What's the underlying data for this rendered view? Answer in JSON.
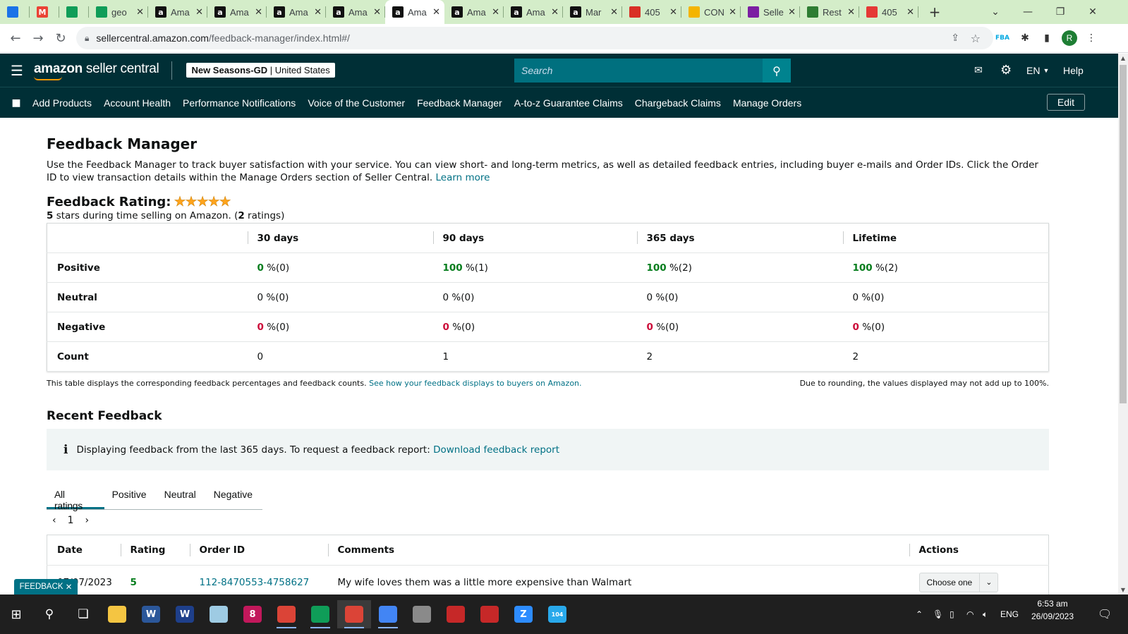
{
  "browser": {
    "tabs": [
      {
        "label": "",
        "icon": "chrome-app-icon",
        "color": "#1a73e8",
        "narrow": true
      },
      {
        "label": "",
        "icon": "gmail-icon",
        "color": "#ea4335",
        "narrow": true
      },
      {
        "label": "",
        "icon": "google-sheets-plus-icon",
        "color": "#0f9d58",
        "narrow": true
      },
      {
        "label": "geo",
        "icon": "google-sheets-icon",
        "color": "#0f9d58"
      },
      {
        "label": "Ama",
        "icon": "amazon-icon",
        "color": "#111111"
      },
      {
        "label": "Ama",
        "icon": "amazon-icon",
        "color": "#111111"
      },
      {
        "label": "Ama",
        "icon": "amazon-icon",
        "color": "#111111"
      },
      {
        "label": "Ama",
        "icon": "amazon-icon",
        "color": "#111111"
      },
      {
        "label": "Ama",
        "icon": "amazon-icon",
        "color": "#111111",
        "active": true
      },
      {
        "label": "Ama",
        "icon": "amazon-icon",
        "color": "#111111"
      },
      {
        "label": "Ama",
        "icon": "amazon-icon",
        "color": "#111111"
      },
      {
        "label": "Mar",
        "icon": "amazon-icon",
        "color": "#111111"
      },
      {
        "label": "405",
        "icon": "cherries-icon",
        "color": "#d93025"
      },
      {
        "label": "CON",
        "icon": "globe-icon",
        "color": "#f4b400"
      },
      {
        "label": "Selle",
        "icon": "sn-icon",
        "color": "#7b1fa2"
      },
      {
        "label": "Rest",
        "icon": "n-check-icon",
        "color": "#2e7d32"
      },
      {
        "label": "405",
        "icon": "jt-icon",
        "color": "#e53935"
      }
    ],
    "url_host": "sellercentral.amazon.com",
    "url_path": "/feedback-manager/index.html#/"
  },
  "header": {
    "logo_strong": "amazon",
    "logo_rest": " seller central",
    "store_name": "New Seasons-GD",
    "store_region": "United States",
    "search_placeholder": "Search",
    "language": "EN",
    "help": "Help"
  },
  "nav": {
    "links": [
      "Add Products",
      "Account Health",
      "Performance Notifications",
      "Voice of the Customer",
      "Feedback Manager",
      "A-to-z Guarantee Claims",
      "Chargeback Claims",
      "Manage Orders"
    ],
    "edit": "Edit"
  },
  "page": {
    "title": "Feedback Manager",
    "intro": "Use the Feedback Manager to track buyer satisfaction with your service. You can view short- and long-term metrics, as well as detailed feedback entries, including buyer e-mails and Order IDs. Click the Order ID to view transaction details within the Manage Orders section of Seller Central.",
    "learn_more": "Learn more",
    "rating_title": "Feedback Rating:",
    "rating_stars": 5,
    "summary_stars": "5",
    "summary_mid": " stars during time selling on Amazon. (",
    "summary_count": "2",
    "summary_end": " ratings)"
  },
  "metrics": {
    "columns": [
      "30 days",
      "90 days",
      "365 days",
      "Lifetime"
    ],
    "rows": [
      {
        "label": "Positive",
        "cells": [
          {
            "pct": "0",
            "rest": " %(0)",
            "tone": "g"
          },
          {
            "pct": "100",
            "rest": " %(1)",
            "tone": "g"
          },
          {
            "pct": "100",
            "rest": " %(2)",
            "tone": "g"
          },
          {
            "pct": "100",
            "rest": " %(2)",
            "tone": "g"
          }
        ]
      },
      {
        "label": "Neutral",
        "cells": [
          {
            "pct": "0",
            "rest": " %(0)",
            "tone": ""
          },
          {
            "pct": "0",
            "rest": " %(0)",
            "tone": ""
          },
          {
            "pct": "0",
            "rest": " %(0)",
            "tone": ""
          },
          {
            "pct": "0",
            "rest": " %(0)",
            "tone": ""
          }
        ]
      },
      {
        "label": "Negative",
        "cells": [
          {
            "pct": "0",
            "rest": " %(0)",
            "tone": "r"
          },
          {
            "pct": "0",
            "rest": " %(0)",
            "tone": "r"
          },
          {
            "pct": "0",
            "rest": " %(0)",
            "tone": "r"
          },
          {
            "pct": "0",
            "rest": " %(0)",
            "tone": "r"
          }
        ]
      },
      {
        "label": "Count",
        "cells": [
          {
            "pct": "0",
            "rest": "",
            "tone": "plain"
          },
          {
            "pct": "1",
            "rest": "",
            "tone": "plain"
          },
          {
            "pct": "2",
            "rest": "",
            "tone": "plain"
          },
          {
            "pct": "2",
            "rest": "",
            "tone": "plain"
          }
        ]
      }
    ],
    "footnote": "This table displays the corresponding feedback percentages and feedback counts.",
    "footnote_link": "See how your feedback displays to buyers on Amazon.",
    "rounding": "Due to rounding, the values displayed may not add up to 100%."
  },
  "recent": {
    "title": "Recent Feedback",
    "info_text": "Displaying feedback from the last 365 days. To request a feedback report:",
    "info_link": "Download feedback report",
    "tabs": [
      "All ratings",
      "Positive",
      "Neutral",
      "Negative"
    ],
    "page": "1",
    "headers": [
      "Date",
      "Rating",
      "Order ID",
      "Comments",
      "Actions"
    ],
    "rows": [
      {
        "date": "07/07/2023",
        "rating": "5",
        "order_id": "112-8470553-4758627",
        "comment": "My wife loves them was a little more expensive than Walmart",
        "action": "Choose one"
      }
    ],
    "feedback_tab": "FEEDBACK"
  },
  "taskbar": {
    "apps": [
      {
        "icon": "file-explorer-icon",
        "color": "#f4c542",
        "text": ""
      },
      {
        "icon": "word-icon",
        "color": "#2b579a",
        "text": "W"
      },
      {
        "icon": "word-viewer-icon",
        "color": "#1e3f8a",
        "text": "W"
      },
      {
        "icon": "notepad-icon",
        "color": "#9ecbe3",
        "text": ""
      },
      {
        "icon": "notification-app-icon",
        "color": "#c2185b",
        "text": "8"
      },
      {
        "icon": "chrome-icon",
        "color": "#db4437",
        "text": ""
      },
      {
        "icon": "chrome-icon",
        "color": "#0f9d58",
        "text": ""
      },
      {
        "icon": "chrome-icon",
        "color": "#db4437",
        "text": "",
        "active": true
      },
      {
        "icon": "chrome-icon",
        "color": "#4285f4",
        "text": ""
      },
      {
        "icon": "calculator-icon",
        "color": "#8a8a8a",
        "text": ""
      },
      {
        "icon": "pdf-icon",
        "color": "#c62828",
        "text": ""
      },
      {
        "icon": "pdf-icon",
        "color": "#c62828",
        "text": ""
      },
      {
        "icon": "zoom-icon",
        "color": "#2d8cff",
        "text": "Z"
      },
      {
        "icon": "telegram-icon",
        "color": "#29a9eb",
        "text": "104"
      }
    ],
    "language": "ENG",
    "time": "6:53 am",
    "date": "26/09/2023"
  }
}
